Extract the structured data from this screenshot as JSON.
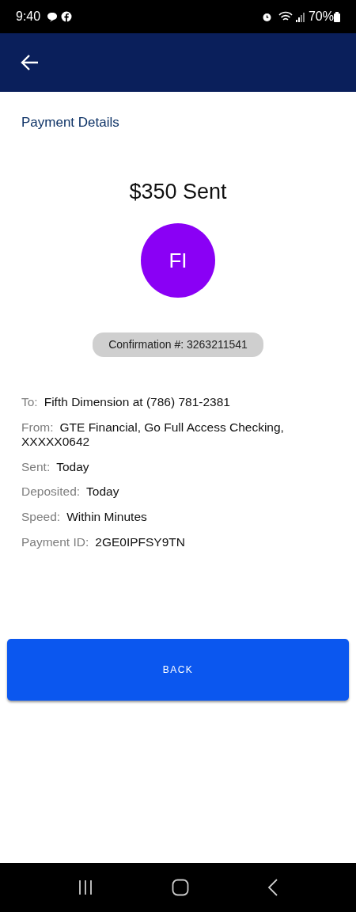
{
  "status_bar": {
    "time": "9:40",
    "battery": "70%"
  },
  "title": "Payment Details",
  "amount_heading": "$350 Sent",
  "avatar": {
    "initials": "FI",
    "color": "#8a00f5"
  },
  "confirmation": "Confirmation #: 3263211541",
  "details": [
    {
      "label": "To:",
      "value": "Fifth Dimension at (786) 781-2381"
    },
    {
      "label": "From:",
      "value": "GTE Financial, Go Full Access Checking, XXXXX0642"
    },
    {
      "label": "Sent:",
      "value": "Today"
    },
    {
      "label": "Deposited:",
      "value": "Today"
    },
    {
      "label": "Speed:",
      "value": "Within Minutes"
    },
    {
      "label": "Payment ID:",
      "value": "2GE0IPFSY9TN"
    }
  ],
  "button": "BACK"
}
